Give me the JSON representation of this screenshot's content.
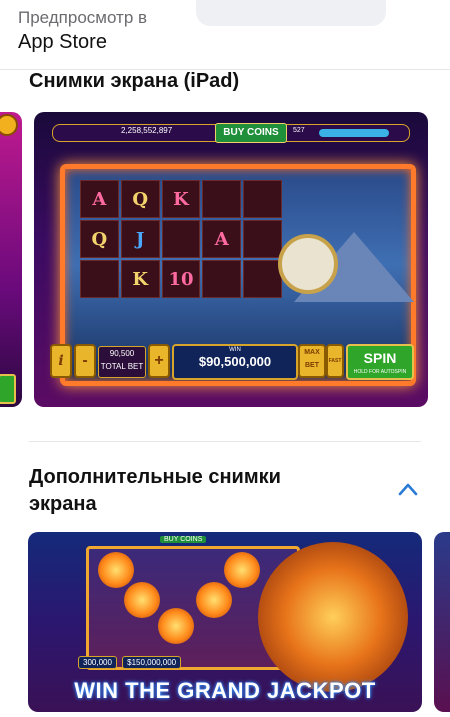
{
  "header": {
    "preview_label": "Предпросмотр в",
    "store_label": "App Store"
  },
  "sections": {
    "ipad_title": "Снимки экрана (iPad)",
    "more_title": "Дополнительные снимки экрана"
  },
  "game": {
    "balance": "2,258,552,897",
    "buy_coins": "BUY COINS",
    "level": "527",
    "progress_label": "64%",
    "reels": [
      "A",
      "Q",
      "K",
      "",
      "",
      "Q",
      "J",
      "",
      "A",
      "",
      "",
      "K",
      "10",
      "",
      ""
    ],
    "total_bet_value": "90,500",
    "total_bet_label": "TOTAL BET",
    "win_label": "WIN",
    "win_amount": "$90,500,000",
    "max_bet": "MAX BET",
    "fast": "FAST",
    "spin": "SPIN",
    "spin_hint": "HOLD FOR AUTOSPIN",
    "info": "i",
    "minus": "-",
    "plus": "+"
  },
  "jackpot": {
    "buy_coins": "BUY COINS",
    "bet_value": "300,000",
    "win_amount": "$150,000,000",
    "tagline": "WIN THE GRAND JACKPOT"
  },
  "colors": {
    "accent_blue": "#2a7bd6",
    "spin_green": "#2fa62a",
    "frame_orange": "#ff7a2a"
  },
  "icons": [
    "chevron-up-icon"
  ]
}
